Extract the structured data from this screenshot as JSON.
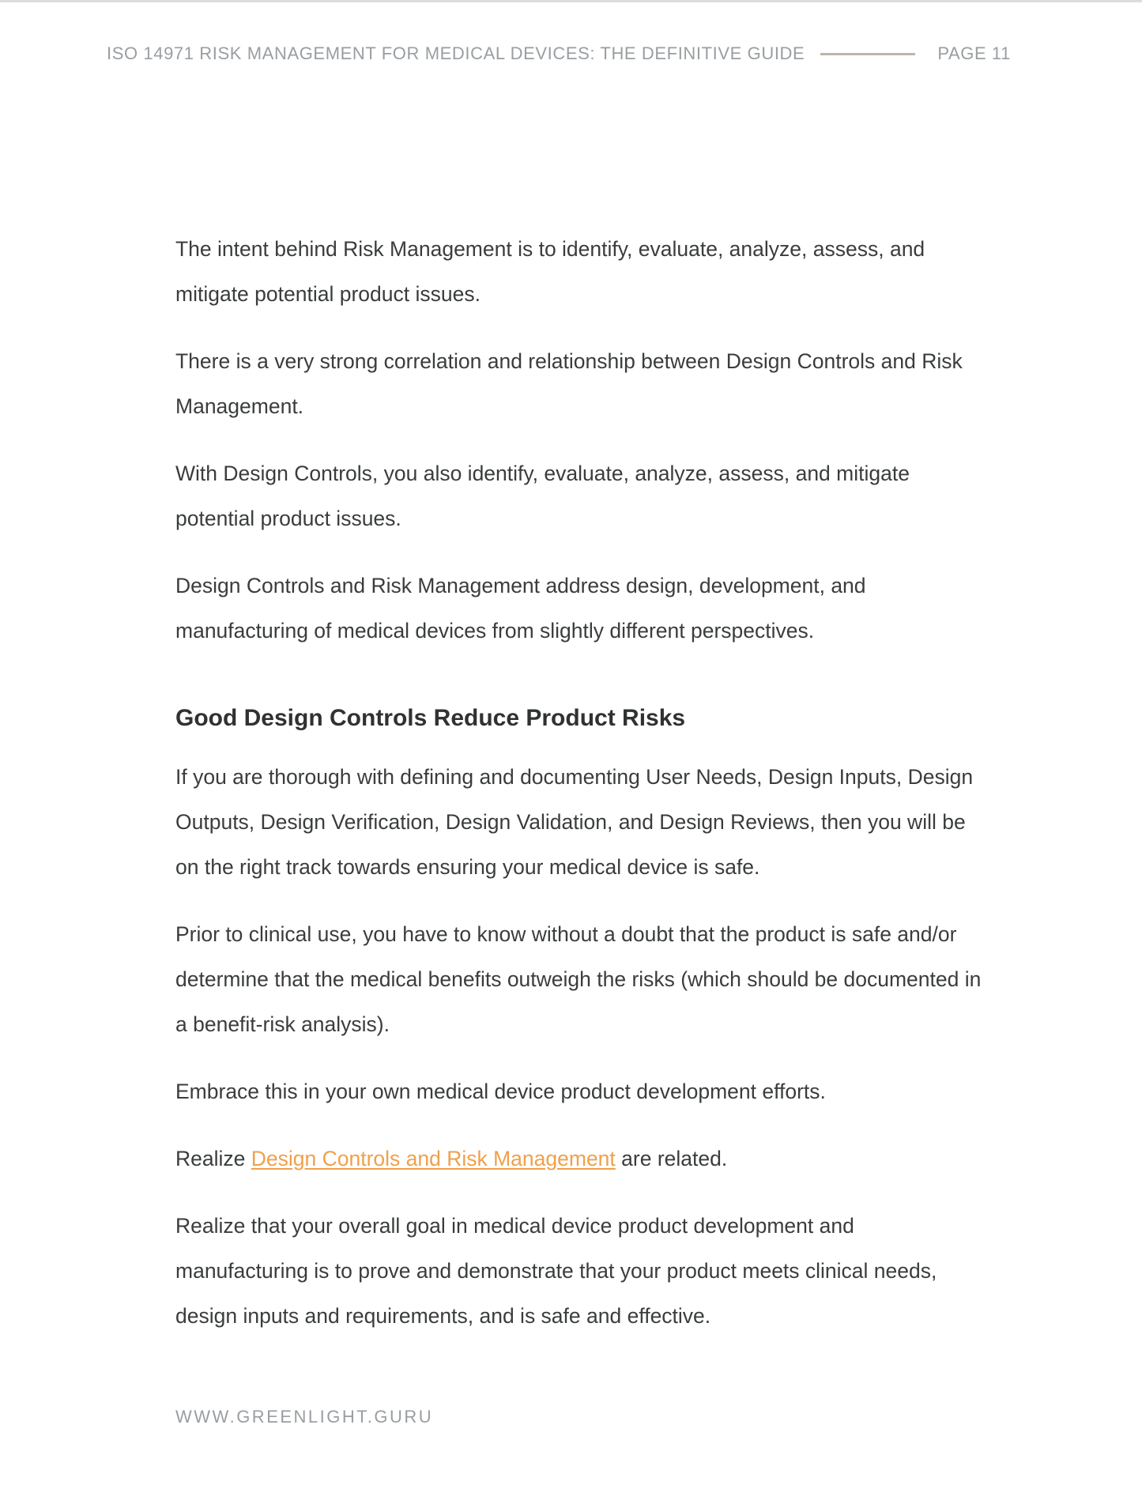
{
  "header": {
    "title": "ISO 14971 RISK MANAGEMENT FOR MEDICAL DEVICES: THE DEFINITIVE GUIDE",
    "page_label": "PAGE 11"
  },
  "body": {
    "paragraphs_intro": [
      "The intent behind Risk Management is to identify, evaluate, analyze, assess, and mitigate potential product issues.",
      "There is a very strong correlation and relationship between Design Controls and Risk Management.",
      "With Design Controls, you also identify, evaluate, analyze, assess, and mitigate potential product issues.",
      "Design Controls and Risk Management address design, development, and manufacturing of medical devices from slightly different perspectives."
    ],
    "section_heading": "Good Design Controls Reduce Product Risks",
    "paragraphs_section": [
      "If you are thorough with defining and documenting User Needs, Design Inputs, Design Outputs, Design Verification, Design Validation, and Design Reviews, then you will be on the right track towards ensuring your medical device is safe.",
      "Prior to clinical use, you have to know without a doubt that the product is safe and/or determine that the medical benefits outweigh the risks (which should be documented in a benefit-risk analysis).",
      "Embrace this in your own medical device product development efforts."
    ],
    "link_paragraph": {
      "before": "Realize ",
      "link_text": "Design Controls and Risk Management",
      "after": " are related."
    },
    "closing_paragraph": "Realize that your overall goal in medical device product development and manufacturing is to prove and demonstrate that your product meets clinical needs, design inputs and requirements, and is safe and effective."
  },
  "footer": {
    "url": "WWW.GREENLIGHT.GURU"
  },
  "colors": {
    "text": "#3a3d3c",
    "muted": "#9a9ea1",
    "link": "#f0a04b",
    "rule": "#bdb5aa"
  }
}
